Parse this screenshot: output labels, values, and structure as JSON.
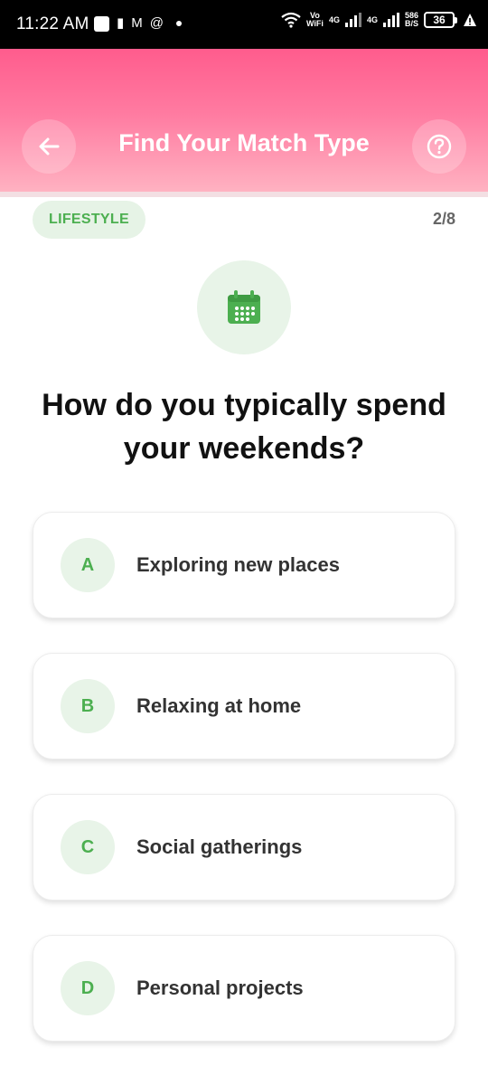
{
  "status_bar": {
    "time": "11:22 AM",
    "vo_wifi_top": "Vo",
    "vo_wifi_bottom": "WiFi",
    "net1": "4G",
    "net2": "4G",
    "speed_top": "586",
    "speed_bottom": "B/S",
    "battery": "36"
  },
  "header": {
    "title": "Find Your Match Type",
    "back_icon": "arrow-left-icon",
    "help_icon": "help-circle-icon"
  },
  "quiz": {
    "category": "LIFESTYLE",
    "progress": "2/8",
    "question_icon": "calendar-icon",
    "question": "How do you typically spend your weekends?",
    "options": [
      {
        "letter": "A",
        "text": "Exploring new places"
      },
      {
        "letter": "B",
        "text": "Relaxing at home"
      },
      {
        "letter": "C",
        "text": "Social gatherings"
      },
      {
        "letter": "D",
        "text": "Personal projects"
      }
    ]
  },
  "colors": {
    "accent_green": "#4caf50",
    "header_pink": "#ff5c8d"
  }
}
